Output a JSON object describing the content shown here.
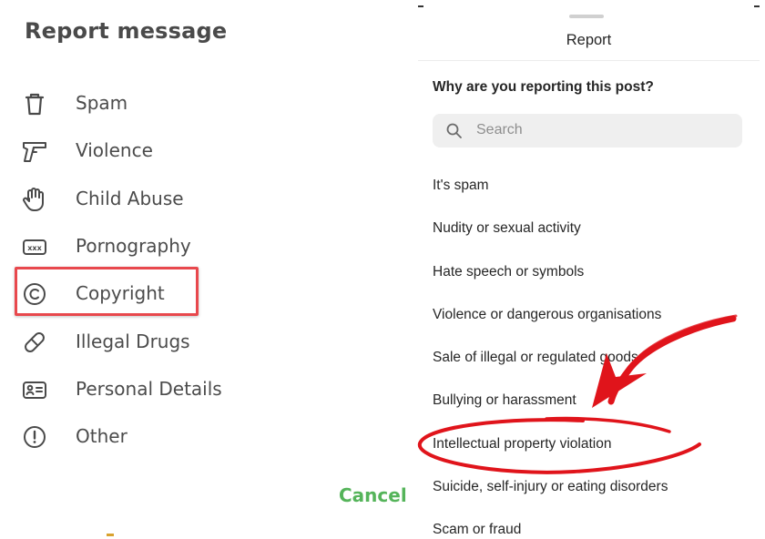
{
  "left_panel": {
    "title": "Report message",
    "options": [
      {
        "label": "Spam",
        "icon": "trash-icon"
      },
      {
        "label": "Violence",
        "icon": "gun-icon"
      },
      {
        "label": "Child Abuse",
        "icon": "hand-icon"
      },
      {
        "label": "Pornography",
        "icon": "xxx-icon"
      },
      {
        "label": "Copyright",
        "icon": "copyright-icon"
      },
      {
        "label": "Illegal Drugs",
        "icon": "pill-icon"
      },
      {
        "label": "Personal Details",
        "icon": "id-card-icon"
      },
      {
        "label": "Other",
        "icon": "exclamation-circle-icon"
      }
    ],
    "highlighted_option": "Copyright",
    "cancel_label": "Cancel",
    "icon_xxx_text": "xxx"
  },
  "right_panel": {
    "title": "Report",
    "question": "Why are you reporting this post?",
    "search_placeholder": "Search",
    "reasons": [
      "It's spam",
      "Nudity or sexual activity",
      "Hate speech or symbols",
      "Violence or dangerous organisations",
      "Sale of illegal or regulated goods",
      "Bullying or harassment",
      "Intellectual property violation",
      "Suicide, self-injury or eating disorders",
      "Scam or fraud"
    ],
    "circled_reason": "Intellectual property violation"
  },
  "colors": {
    "cancel": "#55b45a",
    "highlight_box": "#e8484d",
    "annotation_red": "#e0141b",
    "search_bg": "#efefef",
    "title_text": "#4a4a4a"
  }
}
